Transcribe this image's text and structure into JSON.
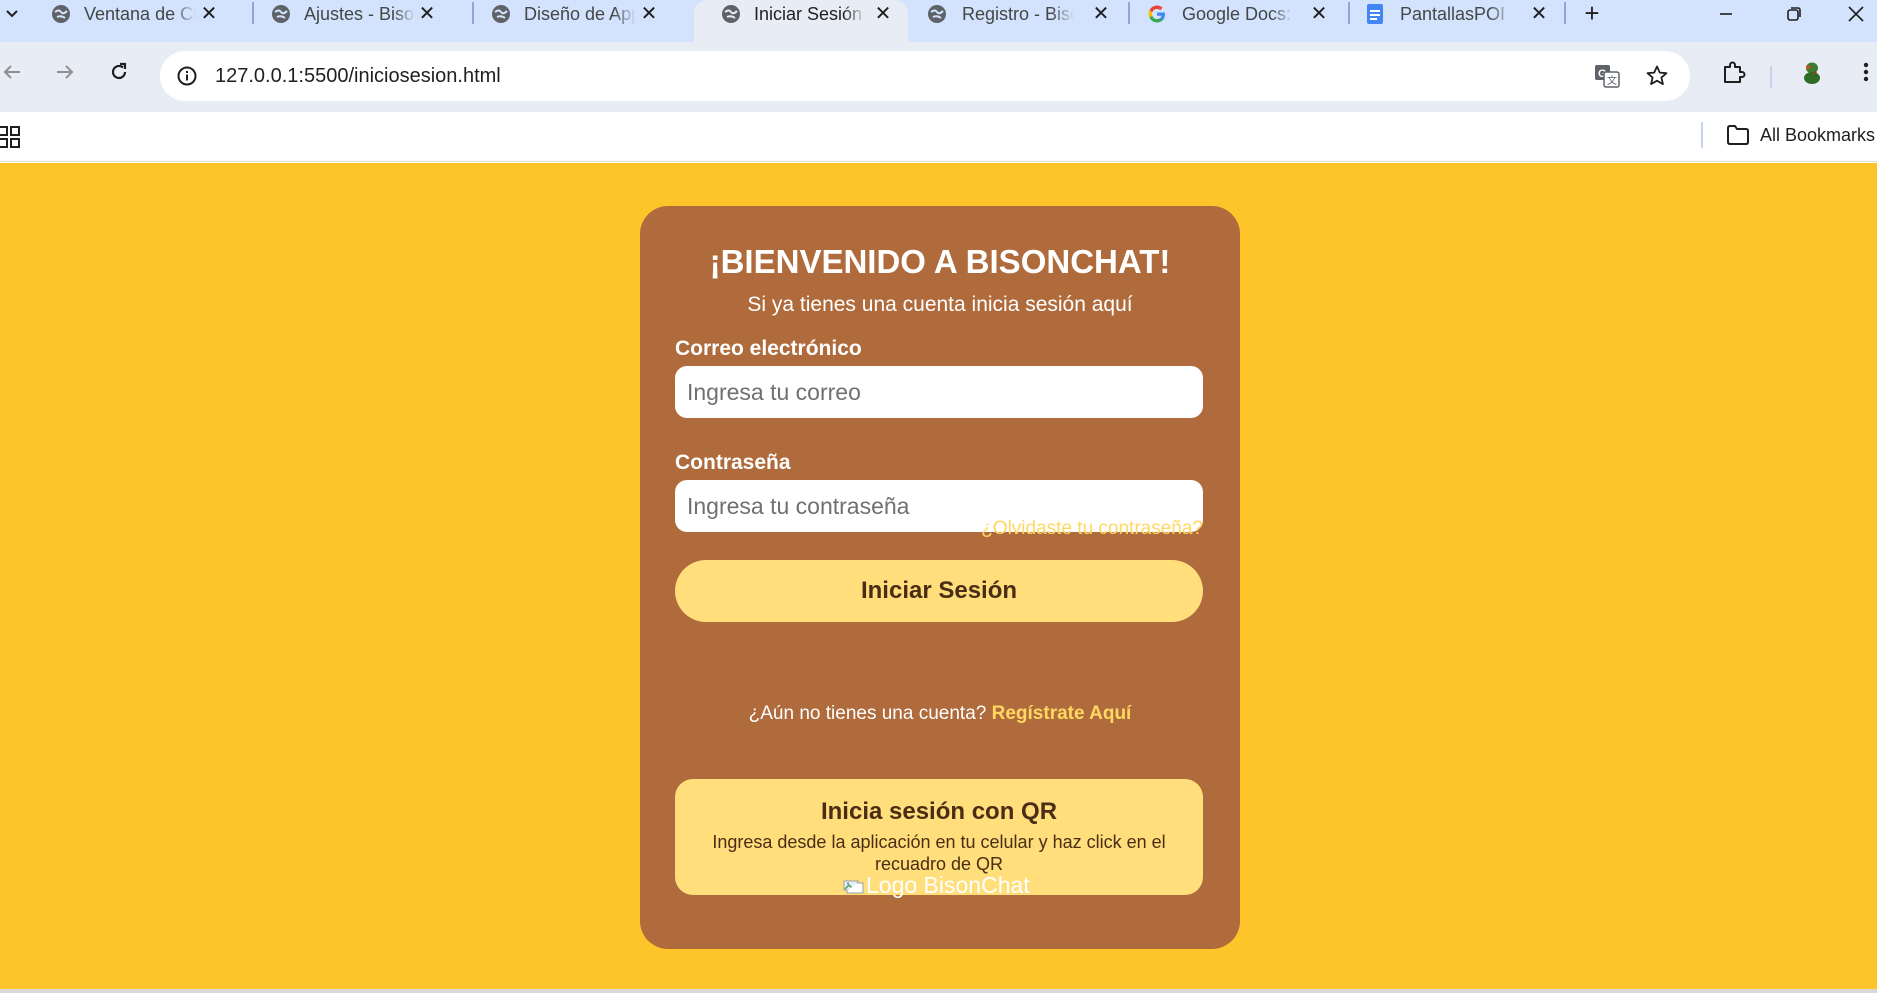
{
  "browser": {
    "tabs": [
      {
        "title": "Ventana de Chat - BisonChat",
        "icon": "globe-icon",
        "active": false
      },
      {
        "title": "Ajustes - BisonChat",
        "icon": "globe-icon",
        "active": false
      },
      {
        "title": "Diseño de App",
        "icon": "globe-icon",
        "active": false
      },
      {
        "title": "Iniciar Sesión - BisonChat",
        "icon": "globe-icon",
        "active": true
      },
      {
        "title": "Registro - BisonChat",
        "icon": "globe-icon",
        "active": false
      },
      {
        "title": "Google Docs: Sign-in",
        "icon": "google-icon",
        "active": false
      },
      {
        "title": "PantallasPOI - Google Docs",
        "icon": "docs-icon",
        "active": false
      }
    ],
    "close_glyph": "✕",
    "new_tab_glyph": "+",
    "url": "127.0.0.1:5500/iniciosesion.html",
    "bookmarks": {
      "all_bookmarks_label": "All Bookmarks"
    },
    "colors": {
      "tabstrip": "#d3e3fd",
      "toolbar": "#e8edf5"
    }
  },
  "page": {
    "background_color": "#fec52b",
    "card_color": "#b06b3c",
    "accent_color": "#ffde7b",
    "link_color": "#ffd863",
    "title": "¡BIENVENIDO A BISONCHAT!",
    "subtitle": "Si ya tienes una cuenta inicia sesión aquí",
    "email": {
      "label": "Correo electrónico",
      "placeholder": "Ingresa tu correo",
      "value": ""
    },
    "password": {
      "label": "Contraseña",
      "placeholder": "Ingresa tu contraseña",
      "value": ""
    },
    "forgot_password": "¿Olvidaste tu contraseña?",
    "login_button": "Iniciar Sesión",
    "signup_prompt": "¿Aún no tienes una cuenta?",
    "signup_link": "Regístrate Aquí",
    "qr": {
      "title": "Inicia sesión con QR",
      "description": "Ingresa desde la aplicación en tu celular y haz click en el recuadro de QR"
    },
    "logo_alt": "Logo BisonChat"
  }
}
